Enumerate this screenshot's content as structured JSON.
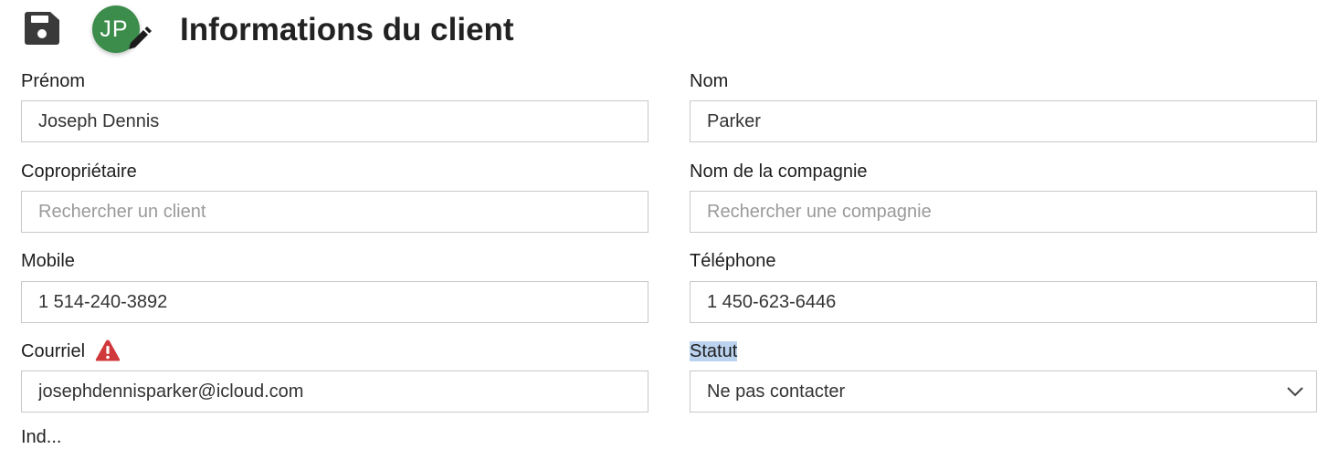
{
  "header": {
    "title": "Informations du client",
    "avatar_initials": "JP",
    "save_icon": "save-icon",
    "edit_icon": "pencil-icon"
  },
  "form": {
    "first_name": {
      "label": "Prénom",
      "value": "Joseph Dennis"
    },
    "last_name": {
      "label": "Nom",
      "value": "Parker"
    },
    "coowner": {
      "label": "Copropriétaire",
      "value": "",
      "placeholder": "Rechercher un client"
    },
    "company": {
      "label": "Nom de la compagnie",
      "value": "",
      "placeholder": "Rechercher une compagnie"
    },
    "mobile": {
      "label": "Mobile",
      "value": "1 514-240-3892"
    },
    "phone": {
      "label": "Téléphone",
      "value": "1 450-623-6446"
    },
    "email": {
      "label": "Courriel",
      "value": "josephdennisparker@icloud.com",
      "warning_icon": "warning-icon"
    },
    "status": {
      "label": "Statut",
      "selected": "Ne pas contacter"
    },
    "next_label_partial": "Ind..."
  },
  "colors": {
    "avatar": "#3c8d4c",
    "warning": "#d0393b",
    "selection_highlight": "#bcd3f0"
  }
}
